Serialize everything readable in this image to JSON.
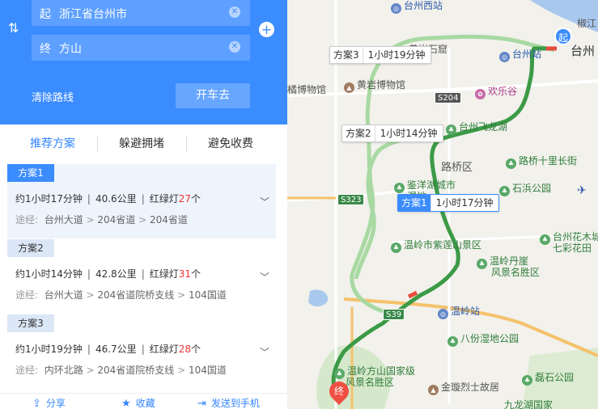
{
  "route": {
    "start_tag": "起",
    "start_value": "浙江省台州市",
    "end_tag": "终",
    "end_value": "方山",
    "clear_label": "清除路线",
    "drive_label": "开车去"
  },
  "tabs": [
    {
      "label": "推荐方案",
      "active": true
    },
    {
      "label": "躲避拥堵",
      "active": false
    },
    {
      "label": "避免收费",
      "active": false
    }
  ],
  "plans": [
    {
      "badge": "方案1",
      "time": "约1小时17分钟",
      "distance": "40.6公里",
      "lights_label": "红绿灯",
      "lights": "27",
      "个": "个",
      "via_label": "途经:",
      "via": [
        "台州大道",
        "204省道",
        "204省道"
      ]
    },
    {
      "badge": "方案2",
      "time": "约1小时14分钟",
      "distance": "42.8公里",
      "lights_label": "红绿灯",
      "lights": "31",
      "个": "个",
      "via_label": "途经:",
      "via": [
        "台州大道",
        "204省道院桥支线",
        "104国道"
      ]
    },
    {
      "badge": "方案3",
      "time": "约1小时19分钟",
      "distance": "46.7公里",
      "lights_label": "红绿灯",
      "lights": "28",
      "个": "个",
      "via_label": "途经:",
      "via": [
        "内环北路",
        "204省道院桥支线",
        "104国道"
      ]
    }
  ],
  "footer": {
    "share": "分享",
    "favorite": "收藏",
    "send": "发送到手机"
  },
  "map": {
    "start_marker": "起",
    "end_marker": "终",
    "route_tags": [
      {
        "name": "方案3",
        "time": "1小时19分钟"
      },
      {
        "name": "方案2",
        "time": "1小时14分钟"
      },
      {
        "name": "方案1",
        "time": "1小时17分钟"
      }
    ],
    "labels": {
      "taizhou_west": "台州西站",
      "jiaojiang": "椒江",
      "huangyan_stone": "黄岩石窟",
      "taizhou_station": "台州站",
      "taizhou": "台州",
      "orange_museum": "橘博物馆",
      "huangyan_museum": "黄岩博物馆",
      "happy_valley": "欢乐谷",
      "taizhou_feilong_lake": "台州飞龙湖",
      "luqiao_west": "路桥十里长街",
      "luqiao_district": "路桥区",
      "jianyang_lake": "鉴洋湖城市",
      "wetland": "湿地",
      "shibin_park": "石浜公园",
      "wenling_zimu": "温岭市紫莲山景区",
      "taizhou_flower": "台州花木城",
      "qicai": "七彩花田",
      "wenling_danya": "温岭丹崖",
      "fengjing": "风景名胜区",
      "wenling_station": "温岭站",
      "bafen_park": "八份湿地公园",
      "fangshan": "温岭方山国家级",
      "fangshan2": "风景名胜区",
      "jinxuan": "金璇烈士故居",
      "leishi_park": "磊石公园",
      "jiulong_lake": "九龙湖国家"
    },
    "shields": {
      "s204": "S204",
      "s323": "S323",
      "s39": "S39"
    }
  }
}
